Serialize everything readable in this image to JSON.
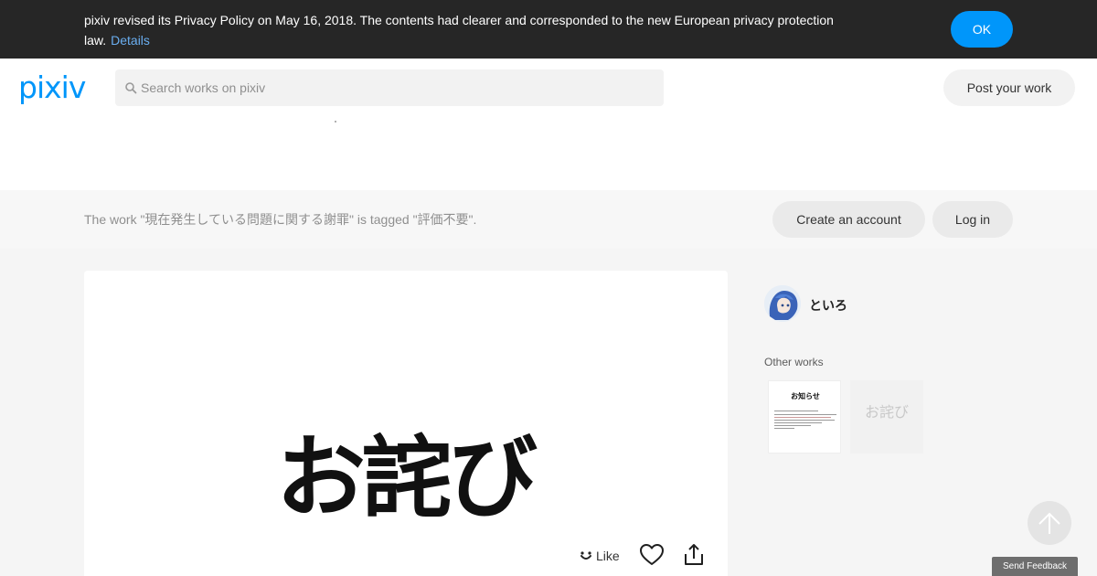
{
  "banner": {
    "text": "pixiv revised its Privacy Policy on May 16, 2018. The contents had clearer and corresponded to the new European privacy protection law.",
    "details_link": "Details",
    "ok_label": "OK"
  },
  "header": {
    "logo": "pixiv",
    "search_placeholder": "Search works on pixiv",
    "post_button": "Post your work"
  },
  "tag_strip": {
    "text": "The work \"現在発生している問題に関する謝罪\" is tagged \"評価不要\".",
    "create_account": "Create an account",
    "login": "Log in"
  },
  "artwork": {
    "title_text": "お詫び",
    "like_label": "Like"
  },
  "sidebar": {
    "username": "といろ",
    "other_works_label": "Other works",
    "thumbnails": [
      {
        "title": "お知らせ"
      },
      {
        "title": "お詫び"
      }
    ]
  },
  "feedback": {
    "label": "Send Feedback"
  },
  "colors": {
    "brand_blue": "#0096fa",
    "banner_bg": "#262626"
  }
}
